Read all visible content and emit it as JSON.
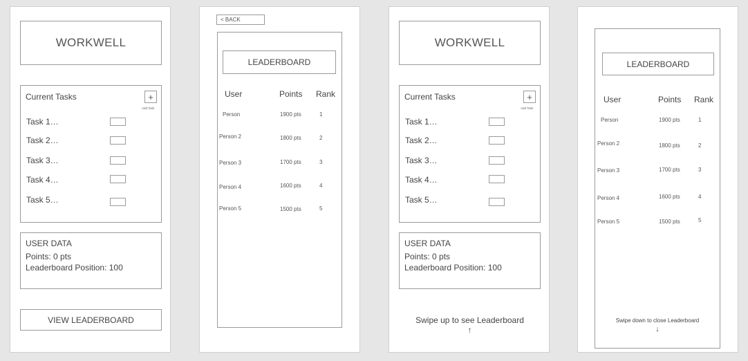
{
  "home": {
    "app_title": "WORKWELL",
    "tasks_title": "Current Tasks",
    "add_button": "+",
    "add_label": "Add Task",
    "tasks": [
      "Task 1…",
      "Task 2…",
      "Task 3…",
      "Task 4…",
      "Task 5…"
    ],
    "user_data_title": "USER DATA",
    "points_line": "Points: 0 pts",
    "position_line": "Leaderboard Position: 100",
    "view_leaderboard": "VIEW LEADERBOARD",
    "swipe_up_text": "Swipe up to see Leaderboard",
    "swipe_up_arrow": "↑"
  },
  "leaderboard": {
    "back_label": "< BACK",
    "title": "LEADERBOARD",
    "columns": [
      "User",
      "Points",
      "Rank"
    ],
    "rows": [
      {
        "user": "Person",
        "points": "1900 pts",
        "rank": "1"
      },
      {
        "user": "Person 2",
        "points": "1800 pts",
        "rank": "2"
      },
      {
        "user": "Person 3",
        "points": "1700 pts",
        "rank": "3"
      },
      {
        "user": "Person 4",
        "points": "1600 pts",
        "rank": "4"
      },
      {
        "user": "Person 5",
        "points": "1500 pts",
        "rank": "5"
      }
    ],
    "swipe_down_text": "Swipe down to close Leaderboard",
    "swipe_down_arrow": "↓"
  }
}
